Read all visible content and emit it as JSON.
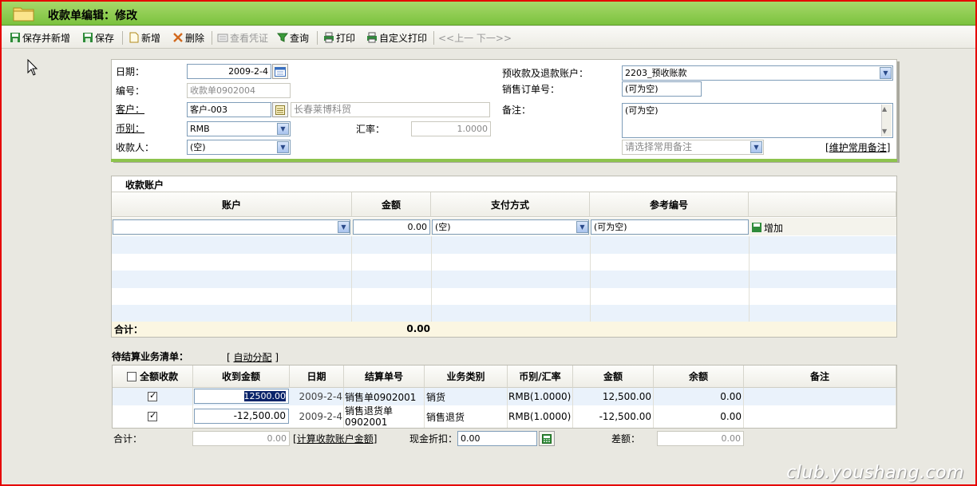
{
  "window": {
    "title": "收款单编辑：修改"
  },
  "toolbar": {
    "save_new": "保存并新增",
    "save": "保存",
    "add": "新增",
    "delete": "删除",
    "view_voucher": "查看凭证",
    "query": "查询",
    "print": "打印",
    "custom_print": "自定义打印",
    "prev_next": "<<上一  下一>>"
  },
  "form": {
    "date_label": "日期：",
    "date_value": "2009-2-4",
    "number_label": "编号：",
    "number_value": "收款单0902004",
    "customer_label": "客户：",
    "customer_code": "客户-003",
    "customer_name": "长春莱博科贸",
    "currency_label": "币别：",
    "currency_value": "RMB",
    "rate_label": "汇率：",
    "rate_value": "1.0000",
    "payee_label": "收款人：",
    "payee_value": "(空)",
    "prepay_account_label": "预收款及退款账户：",
    "prepay_account_value": "2203_预收账款",
    "sales_order_label": "销售订单号：",
    "sales_order_value": "(可为空)",
    "remark_label": "备注：",
    "remark_value": "(可为空)",
    "common_remark_placeholder": "请选择常用备注",
    "maintain_remark": "维护常用备注"
  },
  "accounts": {
    "section_title": "收款账户",
    "columns": [
      "账户",
      "金额",
      "支付方式",
      "参考编号"
    ],
    "entry": {
      "account": "",
      "amount": "0.00",
      "payment_method": "(空)",
      "reference": "(可为空)",
      "add_label": "增加"
    },
    "total_label": "合计：",
    "total_amount": "0.00"
  },
  "settlement": {
    "section_title": "待结算业务清单：",
    "auto_allocate": "自动分配",
    "select_all_label": "全额收款",
    "columns": [
      "收到金额",
      "日期",
      "结算单号",
      "业务类别",
      "币别/汇率",
      "金额",
      "余额",
      "备注"
    ],
    "rows": [
      {
        "checked": true,
        "received": "12500.00",
        "date": "2009-2-4",
        "doc_no": "销售单0902001",
        "type": "销货",
        "currency_rate": "RMB(1.0000)",
        "amount": "12,500.00",
        "balance": "0.00",
        "remark": ""
      },
      {
        "checked": true,
        "received": "-12,500.00",
        "date": "2009-2-4",
        "doc_no": "销售退货单0902001",
        "type": "销售退货",
        "currency_rate": "RMB(1.0000)",
        "amount": "-12,500.00",
        "balance": "0.00",
        "remark": ""
      }
    ],
    "total_label": "合计：",
    "total_value": "0.00",
    "calc_link": "计算收款账户金额",
    "cash_discount_label": "现金折扣：",
    "cash_discount_value": "0.00",
    "difference_label": "差额：",
    "difference_value": "0.00"
  },
  "watermark": "club.youshang.com"
}
